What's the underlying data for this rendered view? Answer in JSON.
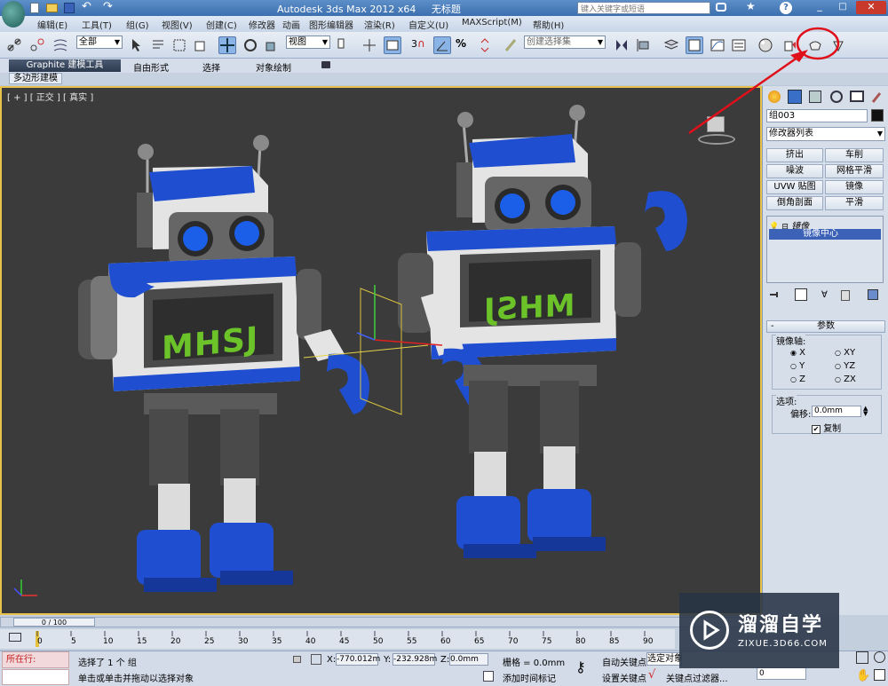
{
  "title": {
    "app": "Autodesk 3ds Max  2012 x64",
    "doc": "无标题",
    "search_placeholder": "键入关键字或短语"
  },
  "menu": [
    "编辑(E)",
    "工具(T)",
    "组(G)",
    "视图(V)",
    "创建(C)",
    "修改器",
    "动画",
    "图形编辑器",
    "渲染(R)",
    "自定义(U)",
    "MAXScript(M)",
    "帮助(H)"
  ],
  "toolbar": {
    "selection_filter": "全部",
    "ref_coord": "视图",
    "named_selection": "创建选择集",
    "snap_3": "3"
  },
  "ribbon": {
    "tabs": [
      "Graphite 建模工具",
      "自由形式",
      "选择",
      "对象绘制"
    ],
    "subtab": "多边形建模"
  },
  "viewport": {
    "label": "[ + ] [ 正交 ] [ 真实 ]",
    "sign_left": "MHSJ",
    "sign_right": "MHSJ"
  },
  "command_panel": {
    "object_name": "组003",
    "modifier_list": "修改器列表",
    "buttons": [
      "挤出",
      "车削",
      "噪波",
      "网格平滑",
      "UVW 贴图",
      "镜像",
      "倒角剖面",
      "平滑"
    ],
    "stack": [
      "镜像",
      "镜像中心"
    ],
    "params_title": "参数",
    "mirror_axis_label": "镜像轴:",
    "axes": [
      "X",
      "XY",
      "Y",
      "YZ",
      "Z",
      "ZX"
    ],
    "options_label": "选项:",
    "offset_label": "偏移:",
    "offset_value": "0.0mm",
    "copy_label": "复制"
  },
  "timeline": {
    "frame": "0 / 100",
    "ticks": [
      "0",
      "5",
      "10",
      "15",
      "20",
      "25",
      "30",
      "35",
      "40",
      "45",
      "50",
      "55",
      "60",
      "65",
      "70",
      "75",
      "80",
      "85",
      "90"
    ]
  },
  "status": {
    "running": "所在行:",
    "selected": "选择了 1 个 组",
    "hint": "单击或单击并拖动以选择对象",
    "x_label": "X:",
    "x_value": "-770.012m",
    "y_label": "Y:",
    "y_value": "-232.928m",
    "z_label": "Z:",
    "z_value": "0.0mm",
    "grid": "栅格 = 0.0mm",
    "add_time_tag": "添加时间标记",
    "auto_key": "自动关键点",
    "auto_key_value": "选定对象",
    "set_key": "设置关键点",
    "key_filter": "关键点过滤器...",
    "frame_value": "0"
  },
  "watermark": {
    "name": "溜溜自学",
    "url": "ZIXUE.3D66.COM"
  },
  "colors": {
    "viewport_bg": "#3b3b3b",
    "robot_blue": "#1f4fd0",
    "robot_white": "#e4e4e4",
    "robot_gray": "#5a5a5a",
    "text_green": "#6bc229",
    "annotation_red": "#e0101a"
  }
}
